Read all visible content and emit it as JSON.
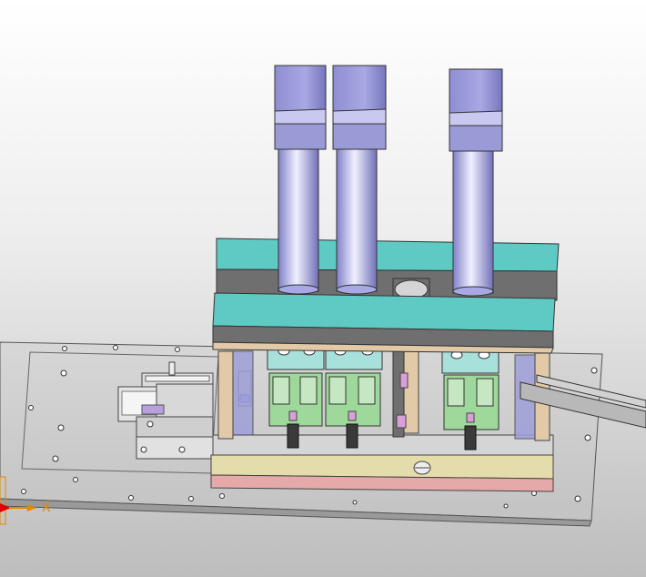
{
  "viewport": {
    "background_top": "#ffffff",
    "background_bottom": "#bdbdbd"
  },
  "model_colors": {
    "base_plate": "#cfcfcf",
    "cylinder_cap": "#9a9ad6",
    "cylinder_body": "#b8b8e8",
    "top_plate": "#5fcac4",
    "frame_block": "#6f6f6f",
    "post": "#e2c9a8",
    "valve_block": "#9ed89a",
    "base_strip_yellow": "#e4dcaa",
    "base_strip_pink": "#e6a9a9",
    "fitting": "#d8a0d8"
  },
  "axis_triad": {
    "x_label": "X",
    "x_color": "#e08a00",
    "origin_color": "#e00000"
  }
}
